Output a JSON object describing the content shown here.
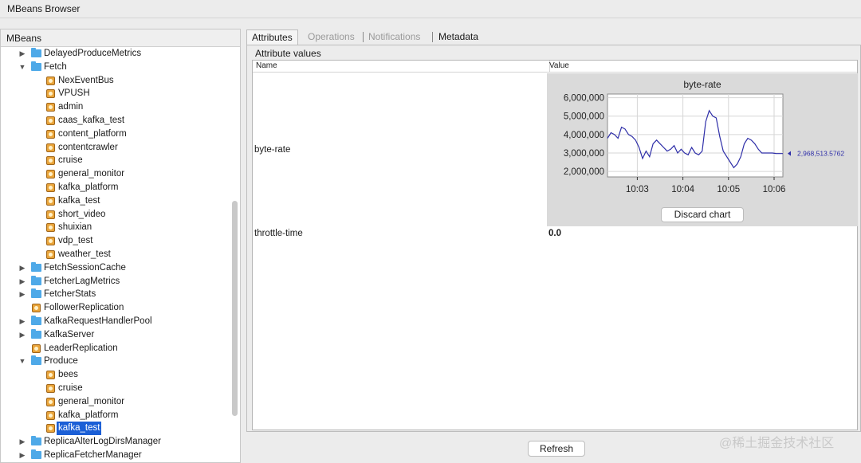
{
  "window": {
    "title": "MBeans Browser"
  },
  "left_panel": {
    "header": "MBeans"
  },
  "tree": [
    {
      "label": "DelayedProduceMetrics",
      "kind": "folder",
      "arrow": "▶",
      "level": 0
    },
    {
      "label": "Fetch",
      "kind": "folder",
      "arrow": "▼",
      "level": 0
    },
    {
      "label": "NexEventBus",
      "kind": "bean",
      "level": 1
    },
    {
      "label": "VPUSH",
      "kind": "bean",
      "level": 1
    },
    {
      "label": "admin",
      "kind": "bean",
      "level": 1
    },
    {
      "label": "caas_kafka_test",
      "kind": "bean",
      "level": 1
    },
    {
      "label": "content_platform",
      "kind": "bean",
      "level": 1
    },
    {
      "label": "contentcrawler",
      "kind": "bean",
      "level": 1
    },
    {
      "label": "cruise",
      "kind": "bean",
      "level": 1
    },
    {
      "label": "general_monitor",
      "kind": "bean",
      "level": 1
    },
    {
      "label": "kafka_platform",
      "kind": "bean",
      "level": 1
    },
    {
      "label": "kafka_test",
      "kind": "bean",
      "level": 1
    },
    {
      "label": "short_video",
      "kind": "bean",
      "level": 1
    },
    {
      "label": "shuixian",
      "kind": "bean",
      "level": 1
    },
    {
      "label": "vdp_test",
      "kind": "bean",
      "level": 1
    },
    {
      "label": "weather_test",
      "kind": "bean",
      "level": 1
    },
    {
      "label": "FetchSessionCache",
      "kind": "folder",
      "arrow": "▶",
      "level": 0
    },
    {
      "label": "FetcherLagMetrics",
      "kind": "folder",
      "arrow": "▶",
      "level": 0
    },
    {
      "label": "FetcherStats",
      "kind": "folder",
      "arrow": "▶",
      "level": 0
    },
    {
      "label": "FollowerReplication",
      "kind": "bean",
      "level": 0
    },
    {
      "label": "KafkaRequestHandlerPool",
      "kind": "folder",
      "arrow": "▶",
      "level": 0
    },
    {
      "label": "KafkaServer",
      "kind": "folder",
      "arrow": "▶",
      "level": 0
    },
    {
      "label": "LeaderReplication",
      "kind": "bean",
      "level": 0
    },
    {
      "label": "Produce",
      "kind": "folder",
      "arrow": "▼",
      "level": 0
    },
    {
      "label": "bees",
      "kind": "bean",
      "level": 1
    },
    {
      "label": "cruise",
      "kind": "bean",
      "level": 1
    },
    {
      "label": "general_monitor",
      "kind": "bean",
      "level": 1
    },
    {
      "label": "kafka_platform",
      "kind": "bean",
      "level": 1
    },
    {
      "label": "kafka_test",
      "kind": "bean",
      "level": 1,
      "selected": true
    },
    {
      "label": "ReplicaAlterLogDirsManager",
      "kind": "folder",
      "arrow": "▶",
      "level": 0
    },
    {
      "label": "ReplicaFetcherManager",
      "kind": "folder",
      "arrow": "▶",
      "level": 0
    }
  ],
  "tabs": [
    {
      "label": "Attributes",
      "state": "active"
    },
    {
      "label": "Operations",
      "state": "disabled"
    },
    {
      "label": "Notifications",
      "state": "disabled"
    },
    {
      "label": "Metadata",
      "state": "normal"
    }
  ],
  "attributes": {
    "section_title": "Attribute values",
    "col_name": "Name",
    "col_value": "Value",
    "rows": [
      {
        "name": "byte-rate",
        "value": ""
      },
      {
        "name": "throttle-time",
        "value": "0.0"
      }
    ]
  },
  "chart_data": {
    "type": "line",
    "title": "byte-rate",
    "xlabel": "",
    "ylabel": "",
    "x_ticks": [
      "10:03",
      "10:04",
      "10:05",
      "10:06"
    ],
    "y_ticks": [
      "6,000,000",
      "5,000,000",
      "4,000,000",
      "3,000,000",
      "2,000,000"
    ],
    "ylim": [
      1700000,
      6200000
    ],
    "xlim": [
      0,
      100
    ],
    "current_value_label": "2,968,513.5762",
    "series": [
      {
        "x": [
          0,
          2,
          4,
          6,
          8,
          10,
          12,
          14,
          16,
          18,
          20,
          22,
          24,
          26,
          28,
          30,
          32,
          34,
          36,
          38,
          40,
          42,
          44,
          46,
          48,
          50,
          52,
          54,
          56,
          58,
          60,
          62,
          64,
          66,
          68,
          70,
          72,
          74,
          76,
          78,
          80,
          82,
          84,
          86,
          88,
          90,
          92,
          94,
          96,
          98,
          100
        ],
        "values": [
          3800000,
          4100000,
          4000000,
          3800000,
          4400000,
          4300000,
          4000000,
          3900000,
          3700000,
          3300000,
          2700000,
          3100000,
          2800000,
          3500000,
          3700000,
          3500000,
          3300000,
          3100000,
          3200000,
          3400000,
          3000000,
          3200000,
          3000000,
          2900000,
          3300000,
          3000000,
          2900000,
          3100000,
          4700000,
          5300000,
          5000000,
          4900000,
          3900000,
          3100000,
          2800000,
          2500000,
          2200000,
          2400000,
          2800000,
          3500000,
          3800000,
          3700000,
          3500000,
          3200000,
          3000000,
          3000000,
          3000000,
          3000000,
          2970000,
          2968513,
          2968513
        ]
      }
    ],
    "grid": true,
    "legend": "none"
  },
  "buttons": {
    "discard_chart": "Discard chart",
    "refresh": "Refresh"
  },
  "watermark": "@稀土掘金技术社区",
  "colors": {
    "selection": "#1b5fd6",
    "line": "#2e2ea8",
    "folder": "#4ea9e8"
  }
}
